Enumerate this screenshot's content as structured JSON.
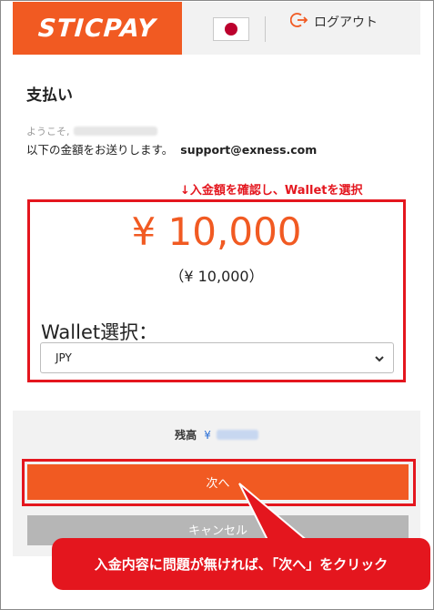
{
  "header": {
    "logo_text": "STICPAY",
    "flag_icon": "japan-flag-icon",
    "logout_label": "ログアウト",
    "logout_icon": "logout-icon"
  },
  "page": {
    "title": "支払い",
    "welcome_prefix": "ようこそ,",
    "send_text": "以下の金額をお送りします。",
    "email": "support@exness.com"
  },
  "annotation": {
    "top_note": "↓入金額を確認し、Walletを選択",
    "callout": "入金内容に問題が無ければ、「次へ」をクリック"
  },
  "amount": {
    "main": "¥ 10,000",
    "sub": "（¥ 10,000）"
  },
  "wallet": {
    "label": "Wallet選択：",
    "selected": "JPY"
  },
  "balance": {
    "label": "残高",
    "currency": "¥"
  },
  "buttons": {
    "next": "次へ",
    "cancel": "キャンセル"
  },
  "colors": {
    "brand": "#f15a22",
    "annotation_red": "#e4161e",
    "panel_gray": "#f2f2f2",
    "cancel_gray": "#b6b6b6"
  }
}
